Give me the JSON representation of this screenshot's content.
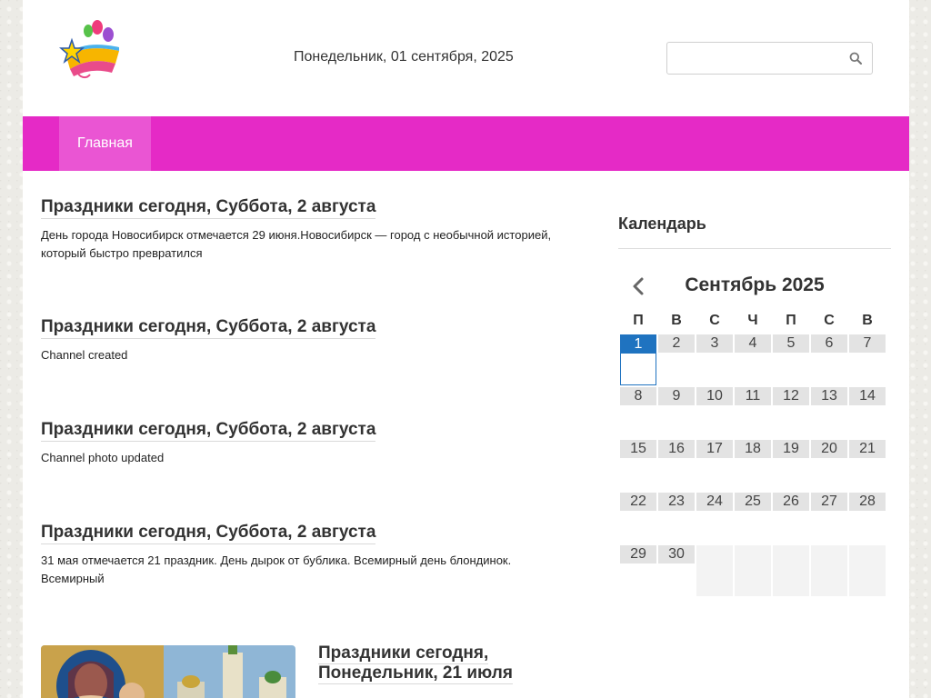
{
  "header": {
    "date": "Понедельник, 01 сентября, 2025",
    "search_placeholder": ""
  },
  "nav": {
    "items": [
      {
        "label": "Главная"
      }
    ]
  },
  "posts": [
    {
      "title": "Праздники сегодня, Суббота, 2 августа",
      "excerpt": "День города Новосибирск отмечается 29 июня.Новосибирск — город с необычной историей, который быстро превратился"
    },
    {
      "title": "Праздники сегодня, Суббота, 2 августа",
      "excerpt": "Channel created"
    },
    {
      "title": "Праздники сегодня, Суббота, 2 августа",
      "excerpt": "Channel photo updated"
    },
    {
      "title": "Праздники сегодня, Суббота, 2 августа",
      "excerpt": " 31 мая отмечается 21 праздник. День дырок от бублика. Всемирный день блондинок. Всемирный"
    },
    {
      "title": "Праздники сегодня, Понедельник, 21 июля",
      "excerpt": ""
    }
  ],
  "sidebar": {
    "widget_title": "Календарь",
    "calendar": {
      "month": "Сентябрь 2025",
      "weekdays": [
        "П",
        "В",
        "С",
        "Ч",
        "П",
        "С",
        "В"
      ],
      "weeks": [
        [
          "1",
          "2",
          "3",
          "4",
          "5",
          "6",
          "7"
        ],
        [
          "8",
          "9",
          "10",
          "11",
          "12",
          "13",
          "14"
        ],
        [
          "15",
          "16",
          "17",
          "18",
          "19",
          "20",
          "21"
        ],
        [
          "22",
          "23",
          "24",
          "25",
          "26",
          "27",
          "28"
        ],
        [
          "29",
          "30",
          "",
          "",
          "",
          "",
          ""
        ]
      ],
      "today": "1"
    }
  },
  "colors": {
    "nav_bg": "#e52ac6",
    "nav_active": "#ea55d3",
    "today": "#1f73c0"
  }
}
